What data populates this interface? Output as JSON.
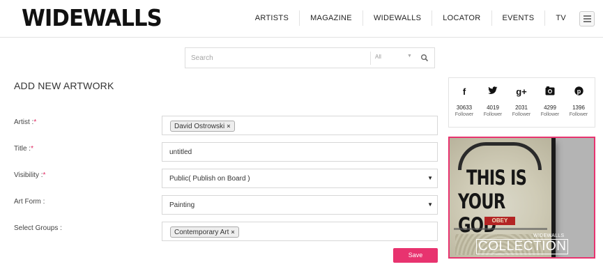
{
  "header": {
    "logo": "WIDEWALLS",
    "nav": [
      {
        "label": "ARTISTS"
      },
      {
        "label": "MAGAZINE"
      },
      {
        "label": "WIDEWALLS"
      },
      {
        "label": "LOCATOR"
      },
      {
        "label": "EVENTS"
      },
      {
        "label": "TV"
      }
    ],
    "menu_icon": "hamburger-menu-icon"
  },
  "search": {
    "placeholder": "Search",
    "category_value": "All",
    "icon": "search-icon"
  },
  "form": {
    "title": "ADD NEW ARTWORK",
    "artist": {
      "label": "Artist :",
      "required": "*",
      "tag": "David Ostrowski",
      "remove": "×"
    },
    "title_field": {
      "label": "Title :",
      "required": "*",
      "value": "untitled"
    },
    "visibility": {
      "label": "Visibility :",
      "required": "*",
      "value": "Public( Publish on Board )",
      "arrow": "▼"
    },
    "art_form": {
      "label": "Art Form :",
      "value": "Painting",
      "arrow": "▼"
    },
    "groups": {
      "label": "Select Groups :",
      "tag": "Contemporary Art",
      "remove": "×"
    },
    "save_label": "Save"
  },
  "social": [
    {
      "icon": "facebook-icon",
      "glyph": "f",
      "count": "30633",
      "label": "Follower"
    },
    {
      "icon": "twitter-icon",
      "glyph": "🐦",
      "count": "4019",
      "label": "Follower"
    },
    {
      "icon": "google-plus-icon",
      "glyph": "g+",
      "count": "2031",
      "label": "Follower"
    },
    {
      "icon": "instagram-icon",
      "glyph": "◘",
      "count": "4299",
      "label": "Follower"
    },
    {
      "icon": "pinterest-icon",
      "glyph": "℗",
      "count": "1396",
      "label": "Follower"
    }
  ],
  "banner": {
    "art_line1": "THIS IS",
    "art_line2": "YOUR GOD",
    "art_badge": "OBEY",
    "brand_small": "WIDEWALLS",
    "brand_big": "COLLECTION"
  },
  "colors": {
    "accent": "#e8336f",
    "border": "#d7d7d7"
  }
}
